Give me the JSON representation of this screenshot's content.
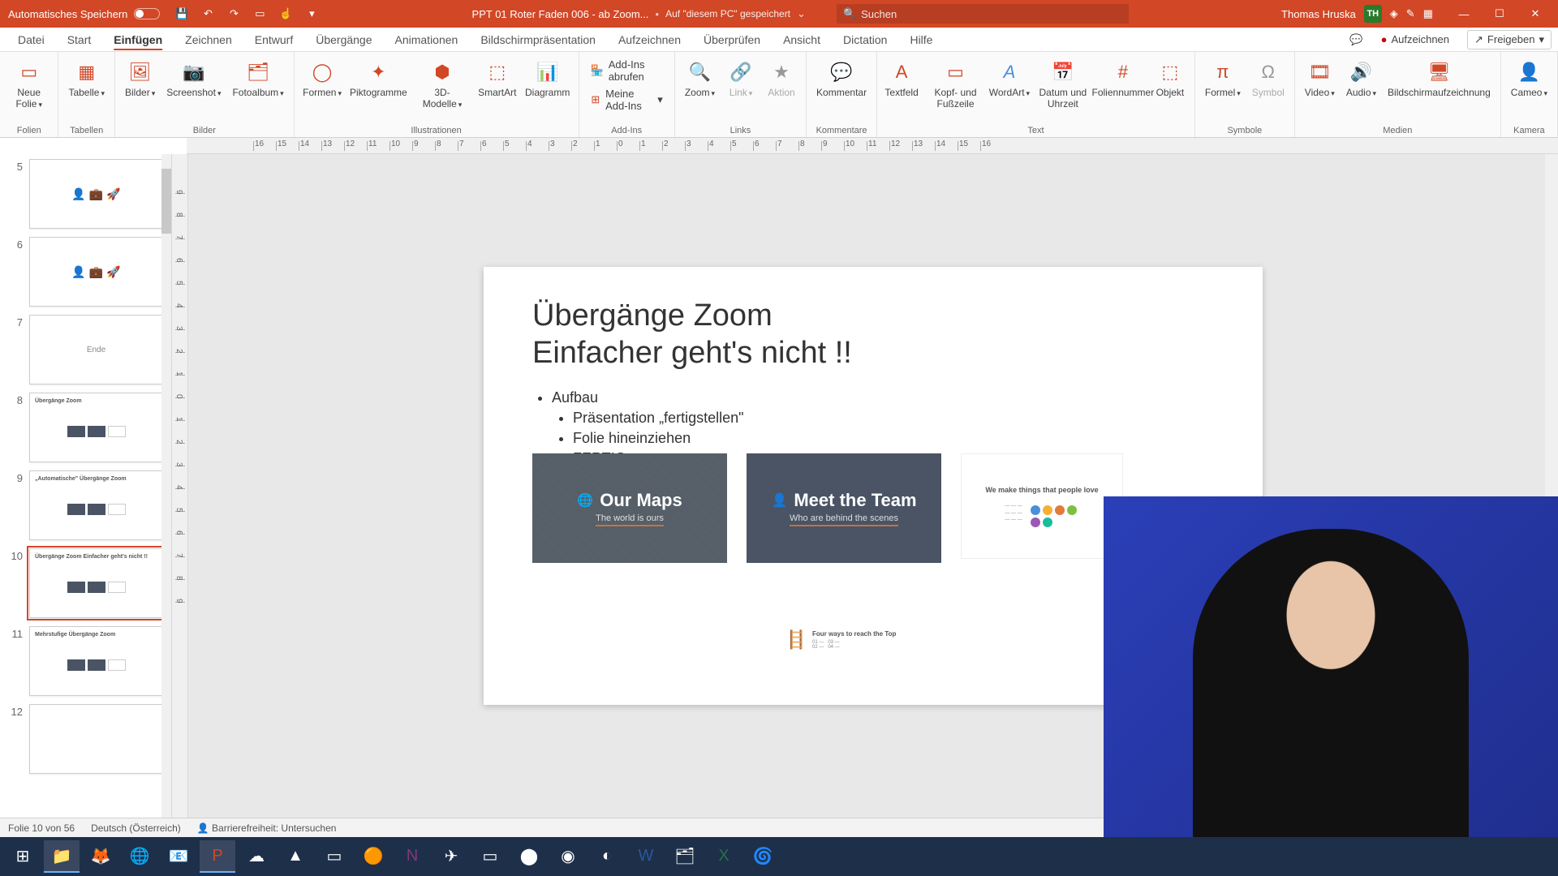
{
  "titlebar": {
    "autosave": "Automatisches Speichern",
    "filename": "PPT 01 Roter Faden 006 - ab Zoom...",
    "saved_hint": "Auf \"diesem PC\" gespeichert",
    "search_placeholder": "Suchen",
    "user_name": "Thomas Hruska",
    "user_initials": "TH"
  },
  "tabs": {
    "items": [
      "Datei",
      "Start",
      "Einfügen",
      "Zeichnen",
      "Entwurf",
      "Übergänge",
      "Animationen",
      "Bildschirmpräsentation",
      "Aufzeichnen",
      "Überprüfen",
      "Ansicht",
      "Dictation",
      "Hilfe"
    ],
    "active": "Einfügen",
    "record": "Aufzeichnen",
    "share": "Freigeben"
  },
  "ribbon": {
    "folien": {
      "label": "Folien",
      "new": "Neue Folie"
    },
    "tabellen": {
      "label": "Tabellen",
      "table": "Tabelle"
    },
    "bilder": {
      "label": "Bilder",
      "bilder": "Bilder",
      "screenshot": "Screenshot",
      "fotoalbum": "Fotoalbum"
    },
    "illustrationen": {
      "label": "Illustrationen",
      "formen": "Formen",
      "piktogramme": "Piktogramme",
      "modelle": "3D-Modelle",
      "smartart": "SmartArt",
      "diagramm": "Diagramm"
    },
    "addins": {
      "label": "Add-Ins",
      "fetch": "Add-Ins abrufen",
      "mine": "Meine Add-Ins"
    },
    "links": {
      "label": "Links",
      "zoom": "Zoom",
      "link": "Link",
      "aktion": "Aktion"
    },
    "kommentare": {
      "label": "Kommentare",
      "kommentar": "Kommentar"
    },
    "text": {
      "label": "Text",
      "textfeld": "Textfeld",
      "kopf": "Kopf- und Fußzeile",
      "wordart": "WordArt",
      "datum": "Datum und Uhrzeit",
      "folien": "Foliennummer",
      "objekt": "Objekt"
    },
    "symbole": {
      "label": "Symbole",
      "formel": "Formel",
      "symbol": "Symbol"
    },
    "medien": {
      "label": "Medien",
      "video": "Video",
      "audio": "Audio",
      "screen": "Bildschirmaufzeichnung"
    },
    "kamera": {
      "label": "Kamera",
      "cameo": "Cameo"
    }
  },
  "thumbs": [
    {
      "num": "5",
      "title": "",
      "kind": "graphic"
    },
    {
      "num": "6",
      "title": "",
      "kind": "graphic"
    },
    {
      "num": "7",
      "title": "Ende",
      "kind": "center"
    },
    {
      "num": "8",
      "title": "Übergänge Zoom",
      "kind": "small"
    },
    {
      "num": "9",
      "title": "„Automatische\" Übergänge Zoom",
      "kind": "small"
    },
    {
      "num": "10",
      "title": "Übergänge Zoom Einfacher geht's nicht !!",
      "kind": "small",
      "selected": true
    },
    {
      "num": "11",
      "title": "Mehrstufige Übergänge Zoom",
      "kind": "small"
    },
    {
      "num": "12",
      "title": "",
      "kind": "blank"
    }
  ],
  "slide": {
    "title_a": "Übergänge Zoom",
    "title_b": "Einfacher geht's nicht !!",
    "b0": "Aufbau",
    "b1": "Präsentation „fertigstellen\"",
    "b2": "Folie hineinziehen",
    "b3": "FERTIG",
    "card_maps_title": "Our Maps",
    "card_maps_sub": "The world is ours",
    "card_team_title": "Meet the Team",
    "card_team_sub": "Who are behind the scenes",
    "card_make": "We make things that people love",
    "card_ladder": "Four ways to reach the Top"
  },
  "status": {
    "slide_of": "Folie 10 von 56",
    "language": "Deutsch (Österreich)",
    "accessibility": "Barrierefreiheit: Untersuchen"
  },
  "colors": {
    "accent": "#d24726"
  }
}
